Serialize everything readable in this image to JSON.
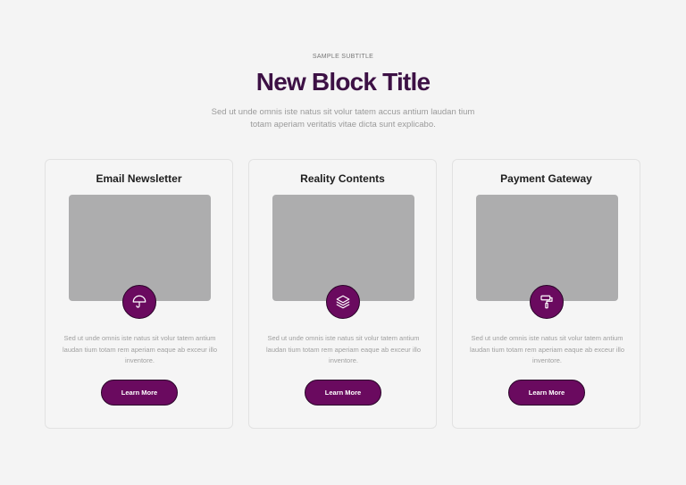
{
  "header": {
    "subtitle": "SAMPLE SUBTITLE",
    "title": "New Block Title",
    "description": "Sed ut unde omnis iste natus sit volur tatem accus antium laudan tium totam aperiam veritatis vitae dicta sunt explicabo."
  },
  "cards": [
    {
      "title": "Email Newsletter",
      "icon": "umbrella-icon",
      "text": "Sed ut unde omnis iste natus sit volur tatem antium laudan tium totam rem aperiam eaque ab exceur illo inventore.",
      "button_label": "Learn More"
    },
    {
      "title": "Reality Contents",
      "icon": "layers-icon",
      "text": "Sed ut unde omnis iste natus sit volur tatem antium laudan tium totam rem aperiam eaque ab exceur illo inventore.",
      "button_label": "Learn More"
    },
    {
      "title": "Payment Gateway",
      "icon": "paint-roller-icon",
      "text": "Sed ut unde omnis iste natus sit volur tatem antium laudan tium totam rem aperiam eaque ab exceur illo inventore.",
      "button_label": "Learn More"
    }
  ],
  "colors": {
    "background": "#f4f4f4",
    "title": "#3d1145",
    "accent": "#6a0a5f",
    "image_placeholder": "#adadae"
  }
}
